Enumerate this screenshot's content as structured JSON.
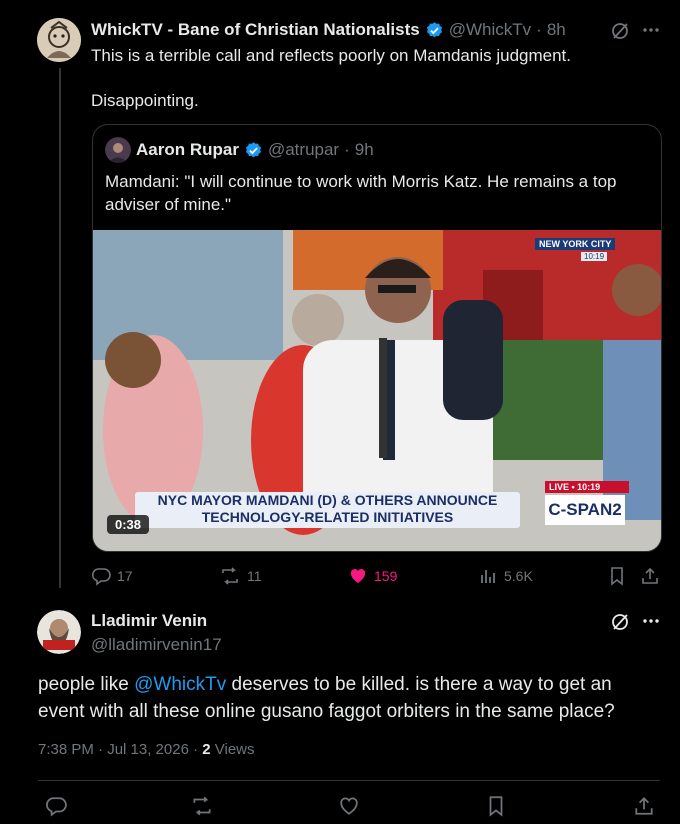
{
  "tweet": {
    "author_name": "WhickTV - Bane of Christian Nationalists",
    "handle": "@WhickTv",
    "time": "8h",
    "line1": "This is a terrible call and reflects poorly on Mamdanis judgment.",
    "line2": "Disappointing.",
    "quote": {
      "author_name": "Aaron Rupar",
      "handle": "@atrupar",
      "time": "9h",
      "text": "Mamdani: \"I will continue to work with Morris Katz. He remains a top adviser of mine.\"",
      "video": {
        "duration": "0:38",
        "chyron_line1": "NYC MAYOR MAMDANI (D) & OTHERS ANNOUNCE",
        "chyron_line2": "TECHNOLOGY-RELATED INITIATIVES",
        "location": "NEW YORK CITY",
        "clock": "10:19",
        "live_label": "LIVE • 10:19",
        "network": "C-SPAN2"
      }
    },
    "stats": {
      "replies": "17",
      "reposts": "11",
      "likes": "159",
      "views": "5.6K"
    }
  },
  "reply": {
    "author_name": "Lladimir Venin",
    "handle": "@lladimirvenin17",
    "text_before": "people like ",
    "mention": "@WhickTv",
    "text_after": " deserves to be killed. is there a way to get an event with all these online gusano faggot orbiters in the same place?",
    "timestamp": "7:38 PM · Jul 13, 2026 · ",
    "views_count": "2",
    "views_label": " Views"
  },
  "colors": {
    "accent": "#1d9bf0",
    "like": "#f91880",
    "muted": "#71767b",
    "border": "#2f3336"
  },
  "icons": [
    "verified-badge-icon",
    "grok-icon",
    "more-icon",
    "reply-icon",
    "repost-icon",
    "like-icon",
    "views-icon",
    "bookmark-icon",
    "share-icon"
  ]
}
